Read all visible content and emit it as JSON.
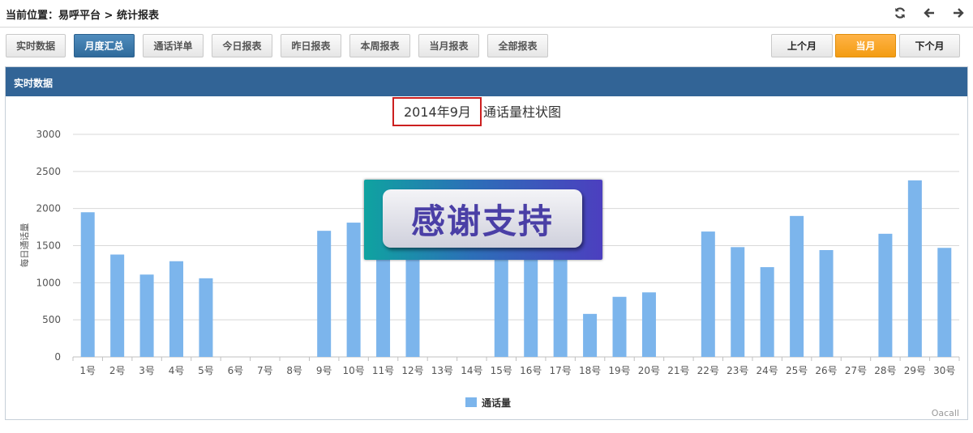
{
  "breadcrumb": {
    "prefix": "当前位置：",
    "platform": "易呼平台",
    "sep": " > ",
    "page": "统计报表"
  },
  "top_icons": [
    "refresh-icon",
    "arrow-left-icon",
    "arrow-right-icon"
  ],
  "toolbar": {
    "tabs": [
      "实时数据",
      "月度汇总",
      "通话详单",
      "今日报表",
      "昨日报表",
      "本周报表",
      "当月报表",
      "全部报表"
    ],
    "active_tab": "月度汇总",
    "month_nav": [
      "上个月",
      "当月",
      "下个月"
    ],
    "active_month": "当月"
  },
  "panel": {
    "title": "实时数据"
  },
  "overlay": {
    "text": "感谢支持"
  },
  "watermark": "Oacall",
  "colors": {
    "accent": "#326496",
    "bar": "#7cb5ec",
    "highlight": "#cc1f1f",
    "orange": "#f7a21c"
  },
  "chart_data": {
    "type": "bar",
    "title_highlight": "2014年9月",
    "title_rest": "通话量柱状图",
    "ylabel": "每日通话量",
    "ylim": [
      0,
      3000
    ],
    "yticks": [
      0,
      500,
      1000,
      1500,
      2000,
      2500,
      3000
    ],
    "categories": [
      "1号",
      "2号",
      "3号",
      "4号",
      "5号",
      "6号",
      "7号",
      "8号",
      "9号",
      "10号",
      "11号",
      "12号",
      "13号",
      "14号",
      "15号",
      "16号",
      "17号",
      "18号",
      "19号",
      "20号",
      "21号",
      "22号",
      "23号",
      "24号",
      "25号",
      "26号",
      "27号",
      "28号",
      "29号",
      "30号"
    ],
    "series": [
      {
        "name": "通话量",
        "values": [
          1950,
          1380,
          1110,
          1290,
          1060,
          0,
          0,
          0,
          1700,
          1810,
          1400,
          1500,
          0,
          0,
          1500,
          1600,
          1650,
          580,
          810,
          870,
          0,
          1690,
          1480,
          1210,
          1900,
          1440,
          0,
          1660,
          2380,
          1470
        ]
      }
    ],
    "legend_position": "bottom",
    "grid": true
  }
}
